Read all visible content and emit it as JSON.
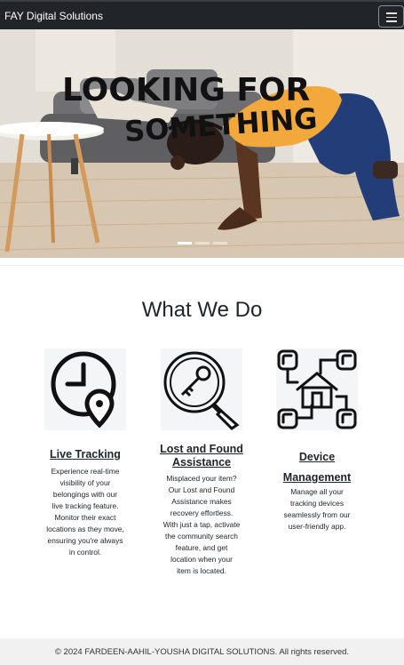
{
  "navbar": {
    "brand": "FAY Digital Solutions",
    "toggle_icon": "hamburger-menu-icon"
  },
  "hero": {
    "overlay_text_line1": "LOOKING FOR",
    "overlay_text_line2": "SOMETHING",
    "slide_count": 3,
    "active_slide": 1
  },
  "section": {
    "title": "What We Do"
  },
  "services": [
    {
      "icon": "clock-location-pin-icon",
      "title": "Live Tracking",
      "text": [
        "Experience real-time",
        "visibility of your",
        "belongings with our",
        "live tracking feature.",
        "Monitor their exact",
        "locations as they move,",
        "ensuring you're always",
        "in control."
      ]
    },
    {
      "icon": "magnifier-key-icon",
      "title_lines": [
        "Lost and Found",
        "Assistance"
      ],
      "text": [
        "Misplaced your item?",
        "Our Lost and Found",
        "Assistance makes",
        "recovery effortless.",
        "With just a tap, activate",
        "the community search",
        "feature, and get",
        "location when your",
        "item is located."
      ]
    },
    {
      "icon": "house-network-icon",
      "title_lines": [
        "Device",
        "Management"
      ],
      "text": [
        "Manage all your",
        "tracking devices",
        "seamlessly from our",
        "user-friendly app."
      ]
    }
  ],
  "footer": {
    "text": "© 2024 FARDEEN-AAHIL-YOUSHA DIGITAL SOLUTIONS. All rights reserved."
  },
  "colors": {
    "navbar": "#212529",
    "footer": "#f1f1f1",
    "shirt": "#f2a83a",
    "jeans": "#1f3a73"
  }
}
